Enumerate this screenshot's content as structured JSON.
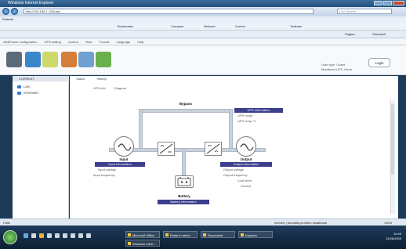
{
  "window": {
    "title": "Windows Internet Explorer",
    "url": "http://192.168.1.115/ups/",
    "search_placeholder": "Live Search"
  },
  "browser_toolbar": {
    "favorites": "Preferiti",
    "links": [
      "Bookmarks",
      "Compare",
      "Network",
      "Control",
      "Toolbars"
    ],
    "tools_label": "Pagina",
    "security_label": "Strumenti"
  },
  "app_menu": [
    "WebPower configuration",
    "UPS setting",
    "Control",
    "View",
    "Format",
    "Language",
    "Help"
  ],
  "header": {
    "user_type_label": "User type",
    "user_type_value": "Guest",
    "monitored_label": "Monitored UPS",
    "monitored_value": "None",
    "login_button": "Login"
  },
  "sidebar": {
    "root": "CURRENT",
    "items": [
      "LAN",
      "INTERNET"
    ]
  },
  "content": {
    "tabs_top": [
      "Status",
      "History"
    ],
    "tabs_sub": [
      "UPS info",
      "Diagram"
    ],
    "bypass_label": "Bypass",
    "ups_info_title": "UPS information",
    "ups_info_rows": [
      "UPS mode",
      "UPS temp      °C"
    ],
    "input_label": "Input",
    "input_info_title": "Input information",
    "input_rows": [
      "Input voltage",
      "Input frequency"
    ],
    "output_label": "Output",
    "output_info_title": "Output information",
    "output_rows": [
      "Output voltage",
      "Output frequency",
      "Load level",
      "Current"
    ],
    "battery_label": "Battery",
    "battery_info_title": "Battery information"
  },
  "statusbar": {
    "left": "Fatto",
    "zone": "Internet | Modalità protetta: disattivata",
    "zoom": "100%"
  },
  "taskbar": {
    "apps": [
      "Microsoft Office",
      "Posta in arrivo",
      "Documenti",
      "Explorer",
      "Windows Intern..."
    ],
    "time": "10:45",
    "date": "11/06/2009"
  },
  "colors": {
    "panel_header": "#3b3f8c",
    "titlebar": "#23507c"
  }
}
